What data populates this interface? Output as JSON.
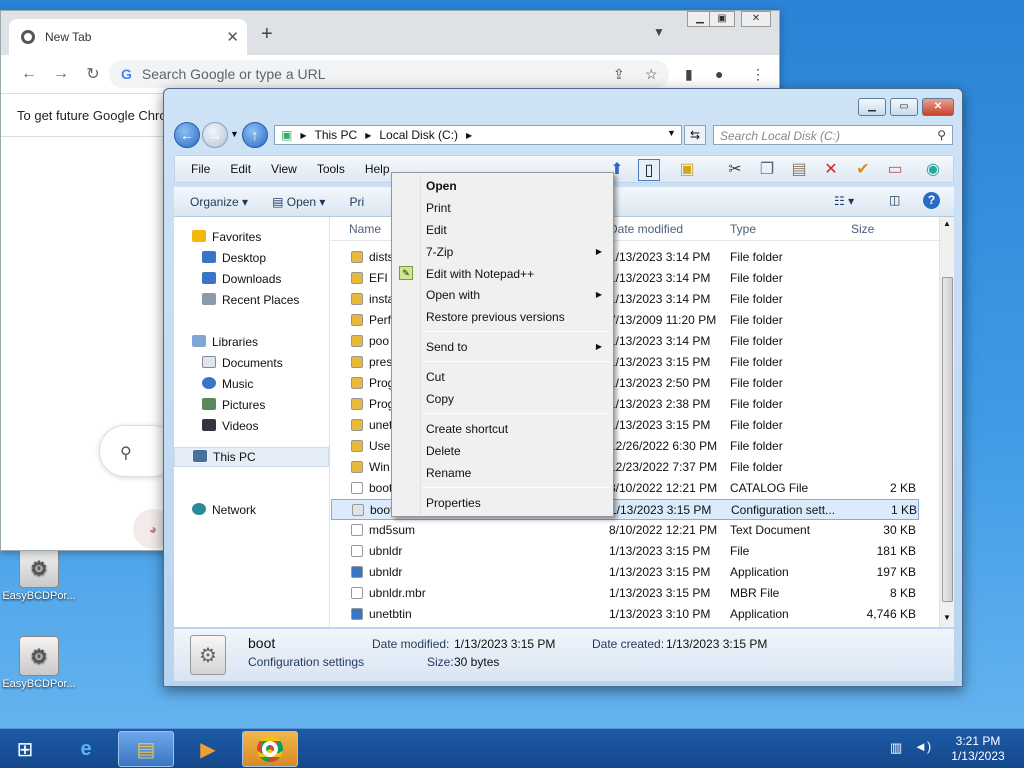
{
  "desktop": {
    "icons": [
      {
        "label": "EasyBCDPor..."
      },
      {
        "label": "EasyBCDPor..."
      }
    ]
  },
  "chrome": {
    "tab_title": "New Tab",
    "omnibox_placeholder": "Search Google or type a URL",
    "infobar_text": "To get future Google Chro",
    "google_g": "G",
    "new_tab_plus": "+"
  },
  "explorer": {
    "breadcrumb": [
      "This PC",
      "Local Disk (C:)"
    ],
    "search_placeholder": "Search Local Disk (C:)",
    "menu": [
      "File",
      "Edit",
      "View",
      "Tools",
      "Help"
    ],
    "commands": {
      "organize": "Organize",
      "open": "Open",
      "print": "Pri"
    },
    "nav": {
      "favorites": "Favorites",
      "desktop": "Desktop",
      "downloads": "Downloads",
      "recent": "Recent Places",
      "libraries": "Libraries",
      "documents": "Documents",
      "music": "Music",
      "pictures": "Pictures",
      "videos": "Videos",
      "thispc": "This PC",
      "network": "Network"
    },
    "columns": {
      "name": "Name",
      "date": "Date modified",
      "type": "Type",
      "size": "Size"
    },
    "files": [
      {
        "name": "dists",
        "date": "1/13/2023 3:14 PM",
        "type": "File folder",
        "size": "",
        "kind": "folder"
      },
      {
        "name": "EFI",
        "date": "1/13/2023 3:14 PM",
        "type": "File folder",
        "size": "",
        "kind": "folder"
      },
      {
        "name": "insta",
        "date": "1/13/2023 3:14 PM",
        "type": "File folder",
        "size": "",
        "kind": "folder"
      },
      {
        "name": "Perf",
        "date": "7/13/2009 11:20 PM",
        "type": "File folder",
        "size": "",
        "kind": "folder"
      },
      {
        "name": "poo",
        "date": "1/13/2023 3:14 PM",
        "type": "File folder",
        "size": "",
        "kind": "folder"
      },
      {
        "name": "pres",
        "date": "1/13/2023 3:15 PM",
        "type": "File folder",
        "size": "",
        "kind": "folder"
      },
      {
        "name": "Prog",
        "date": "1/13/2023 2:50 PM",
        "type": "File folder",
        "size": "",
        "kind": "folder"
      },
      {
        "name": "Prog",
        "date": "1/13/2023 2:38 PM",
        "type": "File folder",
        "size": "",
        "kind": "folder"
      },
      {
        "name": "unet",
        "date": "1/13/2023 3:15 PM",
        "type": "File folder",
        "size": "",
        "kind": "folder"
      },
      {
        "name": "User",
        "date": "12/26/2022 6:30 PM",
        "type": "File folder",
        "size": "",
        "kind": "folder"
      },
      {
        "name": "Win",
        "date": "12/23/2022 7:37 PM",
        "type": "File folder",
        "size": "",
        "kind": "folder"
      },
      {
        "name": "boot",
        "date": "8/10/2022 12:21 PM",
        "type": "CATALOG File",
        "size": "2 KB",
        "kind": "file"
      },
      {
        "name": "boot",
        "date": "1/13/2023 3:15 PM",
        "type": "Configuration sett...",
        "size": "1 KB",
        "kind": "config"
      },
      {
        "name": "md5sum",
        "date": "8/10/2022 12:21 PM",
        "type": "Text Document",
        "size": "30 KB",
        "kind": "file"
      },
      {
        "name": "ubnldr",
        "date": "1/13/2023 3:15 PM",
        "type": "File",
        "size": "181 KB",
        "kind": "file"
      },
      {
        "name": "ubnldr",
        "date": "1/13/2023 3:15 PM",
        "type": "Application",
        "size": "197 KB",
        "kind": "app"
      },
      {
        "name": "ubnldr.mbr",
        "date": "1/13/2023 3:15 PM",
        "type": "MBR File",
        "size": "8 KB",
        "kind": "file"
      },
      {
        "name": "unetbtin",
        "date": "1/13/2023 3:10 PM",
        "type": "Application",
        "size": "4,746 KB",
        "kind": "app"
      }
    ],
    "details": {
      "name": "boot",
      "kind": "Configuration settings",
      "modified_label": "Date modified:",
      "modified": "1/13/2023 3:15 PM",
      "created_label": "Date created:",
      "created": "1/13/2023 3:15 PM",
      "size_label": "Size:",
      "size": "30 bytes"
    }
  },
  "context_menu": {
    "items": [
      {
        "label": "Open"
      },
      {
        "label": "Print"
      },
      {
        "label": "Edit"
      },
      {
        "label": "7-Zip"
      },
      {
        "label": "Edit with Notepad++"
      },
      {
        "label": "Open with"
      },
      {
        "label": "Restore previous versions"
      },
      {
        "label": "Send to"
      },
      {
        "label": "Cut"
      },
      {
        "label": "Copy"
      },
      {
        "label": "Create shortcut"
      },
      {
        "label": "Delete"
      },
      {
        "label": "Rename"
      },
      {
        "label": "Properties"
      }
    ]
  },
  "taskbar": {
    "time": "3:21 PM",
    "date": "1/13/2023"
  }
}
